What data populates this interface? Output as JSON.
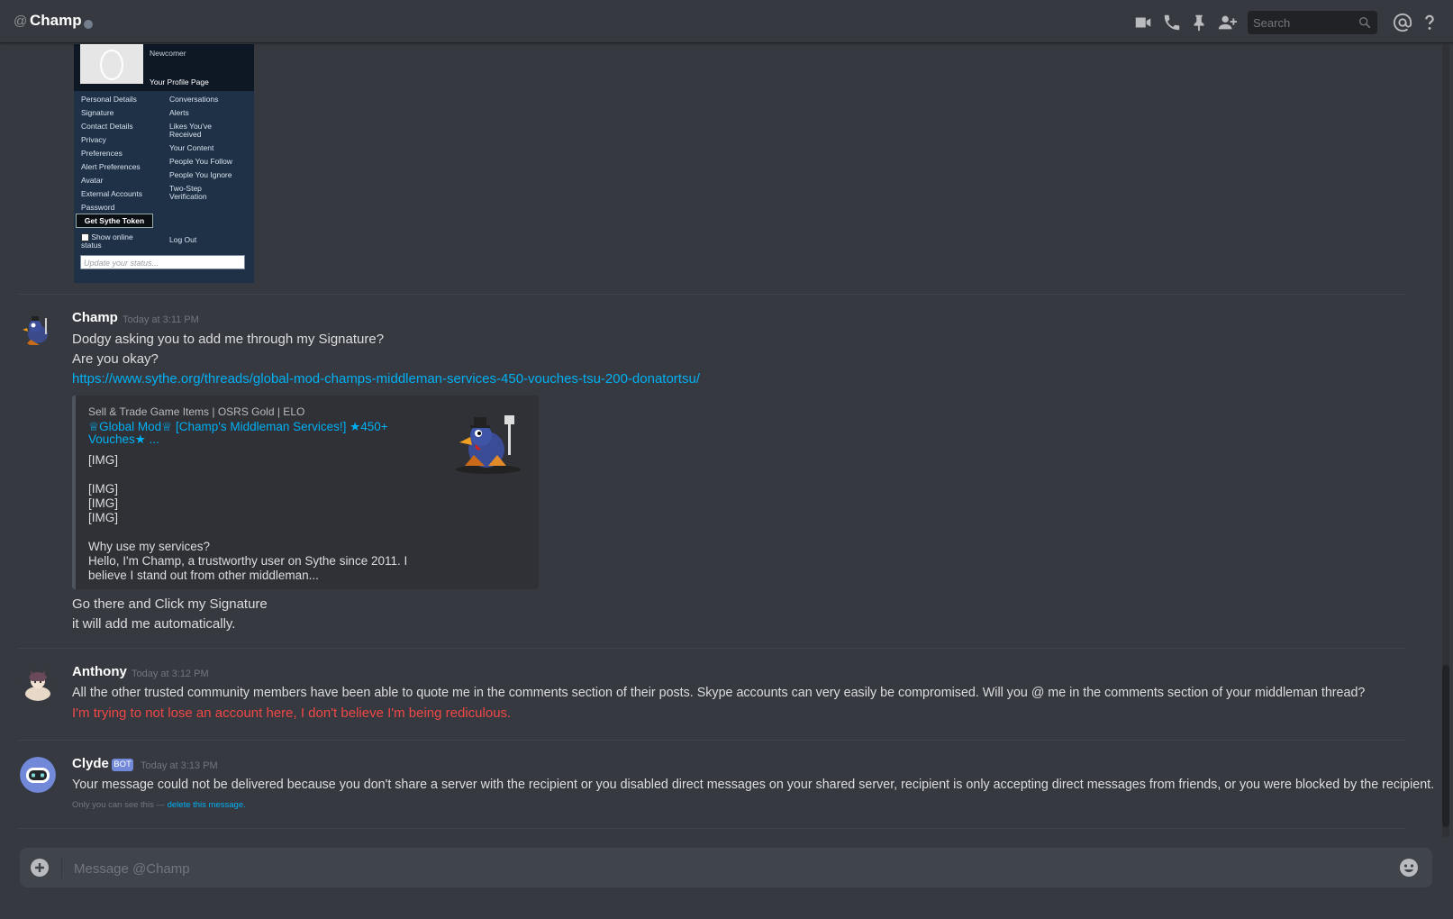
{
  "header": {
    "at_symbol": "@",
    "channel_name": "Champ",
    "search_placeholder": "Search",
    "icons": [
      "video-camera-icon",
      "phone-icon",
      "pin-icon",
      "add-friend-icon",
      "search-icon",
      "mention-icon",
      "help-icon"
    ]
  },
  "profile_attachment": {
    "rank": "Newcomer",
    "page_label": "Your Profile Page",
    "left_menu": [
      "Personal Details",
      "Signature",
      "Contact Details",
      "Privacy",
      "Preferences",
      "Alert Preferences",
      "Avatar",
      "External Accounts",
      "Password"
    ],
    "right_menu": [
      "Conversations",
      "Alerts",
      "Likes You've Received",
      "Your Content",
      "People You Follow",
      "People You Ignore",
      "Two-Step Verification"
    ],
    "token_button": "Get Sythe Token",
    "show_online": "Show online status",
    "logout": "Log Out",
    "status_placeholder": "Update your status..."
  },
  "messages": [
    {
      "author": "Champ",
      "timestamp": "Today at 3:11 PM",
      "lines": [
        "Dodgy asking you to add me through my Signature?",
        "Are you okay?"
      ],
      "link": "https://www.sythe.org/threads/global-mod-champs-middleman-services-450-vouches-tsu-200-donatortsu/",
      "embed": {
        "provider": "Sell & Trade Game Items | OSRS Gold | ELO",
        "title": "♕Global Mod♕ [Champ's Middleman Services!] ★450+ Vouches★ ...",
        "description": "[IMG]\n\n[IMG]\n[IMG]\n[IMG]\n\nWhy use my services?\nHello, I'm Champ, a trustworthy user on Sythe since 2011. I believe I stand out from other middleman..."
      },
      "after_lines": [
        "Go there and Click my Signature",
        "it will add me automatically."
      ]
    },
    {
      "author": "Anthony",
      "timestamp": "Today at 3:12 PM",
      "lines": [
        "All the other trusted community members have been able to quote me in the comments section of their posts. Skype accounts can very easily be compromised. Will you @ me in the comments section of your middleman thread?"
      ],
      "red_line": "I'm trying to not lose an account here, I don't believe I'm being rediculous."
    },
    {
      "author": "Clyde",
      "badge": "BOT",
      "timestamp": "Today at 3:13 PM",
      "lines": [
        "Your message could not be delivered because you don't share a server with the recipient or you disabled direct messages on your shared server, recipient is only accepting direct messages from friends, or you were blocked by the recipient."
      ],
      "ephemeral_note": "Only you can see this —",
      "ephemeral_link": "delete this message."
    }
  ],
  "composer": {
    "placeholder": "Message @Champ"
  },
  "colors": {
    "background": "#36393f",
    "link": "#00b0f4",
    "warning_red": "#f04747",
    "bot_badge": "#7289da"
  }
}
